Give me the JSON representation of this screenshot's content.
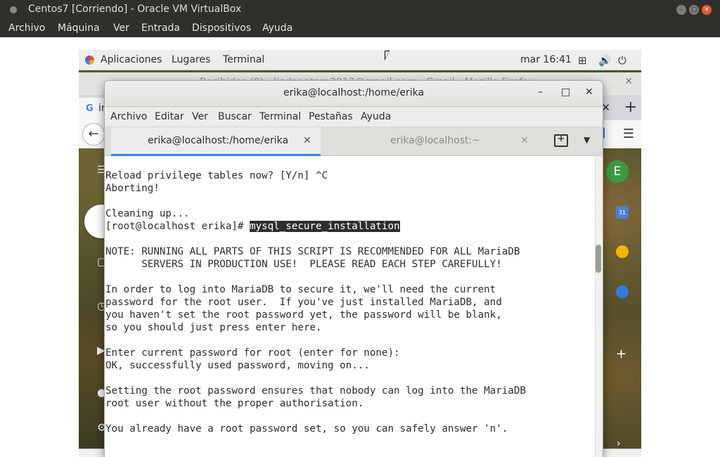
{
  "host": {
    "window_title": "Centos7 [Corriendo] - Oracle VM VirtualBox",
    "menu": [
      "Archivo",
      "Máquina",
      "Ver",
      "Entrada",
      "Dispositivos",
      "Ayuda"
    ]
  },
  "gnome": {
    "applications": "Aplicaciones",
    "places": "Lugares",
    "terminal": "Terminal",
    "clock": "mar 16:41"
  },
  "firefox": {
    "title": "Recibidos (0) - lindanatara2013@gmail.com - Gmail - Mozilla Firefox",
    "tab_fragment": "in",
    "avatar_letter": "E",
    "calendar_day": "31"
  },
  "terminal": {
    "title": "erika@localhost:/home/erika",
    "menu": [
      "Archivo",
      "Editar",
      "Ver",
      "Buscar",
      "Terminal",
      "Pestañas",
      "Ayuda"
    ],
    "tabs": [
      {
        "label": "erika@localhost:/home/erika",
        "active": true
      },
      {
        "label": "erika@localhost:~",
        "active": false
      }
    ],
    "lines": [
      "Reload privilege tables now? [Y/n] ^C",
      "Aborting!",
      "",
      "Cleaning up...",
      "",
      "",
      "NOTE: RUNNING ALL PARTS OF THIS SCRIPT IS RECOMMENDED FOR ALL MariaDB",
      "      SERVERS IN PRODUCTION USE!  PLEASE READ EACH STEP CAREFULLY!",
      "",
      "In order to log into MariaDB to secure it, we'll need the current",
      "password for the root user.  If you've just installed MariaDB, and",
      "you haven't set the root password yet, the password will be blank,",
      "so you should just press enter here.",
      "",
      "Enter current password for root (enter for none):",
      "OK, successfully used password, moving on...",
      "",
      "Setting the root password ensures that nobody can log into the MariaDB",
      "root user without the proper authorisation.",
      "",
      "You already have a root password set, so you can safely answer 'n'."
    ],
    "prompt": "[root@localhost erika]# ",
    "command": "mysql_secure_installation"
  }
}
